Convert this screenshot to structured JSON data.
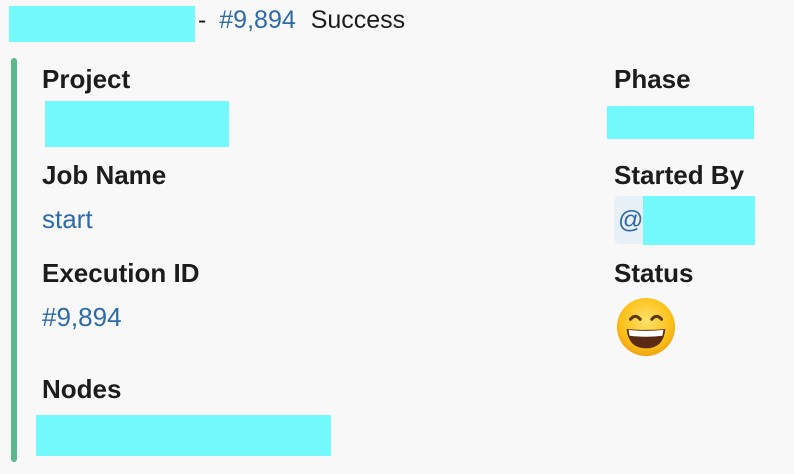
{
  "header": {
    "separator": "-",
    "execution_link": "#9,894",
    "status_text": "Success"
  },
  "fields": {
    "project": {
      "title": "Project"
    },
    "phase": {
      "title": "Phase"
    },
    "job_name": {
      "title": "Job Name",
      "value": "start"
    },
    "started_by": {
      "title": "Started By",
      "mention_prefix": "@"
    },
    "execution_id": {
      "title": "Execution ID",
      "value": "#9,894"
    },
    "status": {
      "title": "Status",
      "emoji": "grinning-face-with-smiling-eyes-icon"
    },
    "nodes": {
      "title": "Nodes"
    }
  },
  "colors": {
    "accent_bar": "#5ab88a",
    "link": "#2d6aa8",
    "redaction": "#73f9fc",
    "background": "#f8f8f8"
  }
}
